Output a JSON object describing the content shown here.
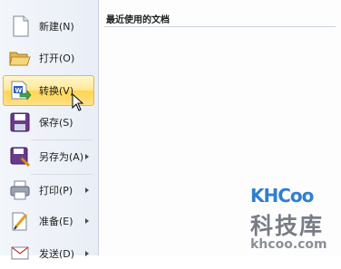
{
  "menu": {
    "items": [
      {
        "label": "新建(N)",
        "icon": "new-document-icon",
        "submenu": false
      },
      {
        "label": "打开(O)",
        "icon": "open-folder-icon",
        "submenu": false
      },
      {
        "label": "转换(V)",
        "icon": "convert-icon",
        "submenu": false,
        "highlighted": true
      },
      {
        "label": "保存(S)",
        "icon": "save-disk-icon",
        "submenu": false
      },
      {
        "label": "另存为(A)",
        "icon": "save-as-icon",
        "submenu": true
      },
      {
        "label": "打印(P)",
        "icon": "printer-icon",
        "submenu": true
      },
      {
        "label": "准备(E)",
        "icon": "prepare-icon",
        "submenu": true
      },
      {
        "label": "发送(D)",
        "icon": "send-icon",
        "submenu": true
      }
    ]
  },
  "recent": {
    "title": "最近使用的文档"
  },
  "watermark": {
    "logo": "KHCoo",
    "cn": "科技库",
    "url": "khcoo.com"
  },
  "colors": {
    "highlight": "#ffe08a",
    "menu_bg": "#eef2f8",
    "accent": "#2f7fd0"
  }
}
